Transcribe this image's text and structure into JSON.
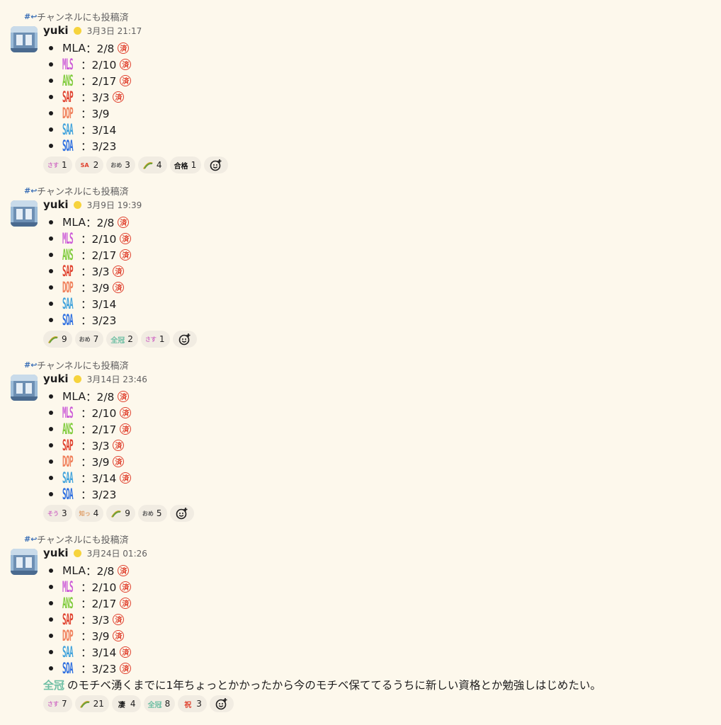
{
  "channel_note": "チャンネルにも投稿済",
  "messages": [
    {
      "user": "yuki",
      "time": "3月3日 21:17",
      "items": [
        {
          "cert": "MLA",
          "plain": true,
          "date": "2/8",
          "done": true
        },
        {
          "cert": "MLS",
          "color": "#cc5ad8",
          "date": "2/10",
          "done": true
        },
        {
          "cert": "ANS",
          "color": "#7ecb3a",
          "date": "2/17",
          "done": true
        },
        {
          "cert": "SAP",
          "color": "#e0412e",
          "date": "3/3",
          "done": true
        },
        {
          "cert": "DOP",
          "color": "#f07f5a",
          "date": "3/9",
          "done": false
        },
        {
          "cert": "SAA",
          "color": "#3fa2dc",
          "date": "3/14",
          "done": false
        },
        {
          "cert": "SOA",
          "color": "#2b6de0",
          "date": "3/23",
          "done": false
        }
      ],
      "reactions": [
        {
          "emoji": "さすが",
          "color": "#d06dc4",
          "count": "1"
        },
        {
          "emoji": "SAP",
          "color": "#e0412e",
          "count": "2"
        },
        {
          "emoji": "おめでとう",
          "color": "#555555",
          "count": "3"
        },
        {
          "emoji": "taco",
          "color": "#b28a26",
          "count": "4"
        },
        {
          "emoji": "合格",
          "color": "#111111",
          "count": "1"
        }
      ]
    },
    {
      "user": "yuki",
      "time": "3月9日 19:39",
      "items": [
        {
          "cert": "MLA",
          "plain": true,
          "date": "2/8",
          "done": true
        },
        {
          "cert": "MLS",
          "color": "#cc5ad8",
          "date": "2/10",
          "done": true
        },
        {
          "cert": "ANS",
          "color": "#7ecb3a",
          "date": "2/17",
          "done": true
        },
        {
          "cert": "SAP",
          "color": "#e0412e",
          "date": "3/3",
          "done": true
        },
        {
          "cert": "DOP",
          "color": "#f07f5a",
          "date": "3/9",
          "done": true
        },
        {
          "cert": "SAA",
          "color": "#3fa2dc",
          "date": "3/14",
          "done": false
        },
        {
          "cert": "SOA",
          "color": "#2b6de0",
          "date": "3/23",
          "done": false
        }
      ],
      "reactions": [
        {
          "emoji": "taco",
          "color": "#b28a26",
          "count": "9"
        },
        {
          "emoji": "おめでとう",
          "color": "#555555",
          "count": "7"
        },
        {
          "emoji": "全冠",
          "color": "#6fbfa4",
          "count": "2"
        },
        {
          "emoji": "さすが",
          "color": "#d06dc4",
          "count": "1"
        }
      ]
    },
    {
      "user": "yuki",
      "time": "3月14日 23:46",
      "items": [
        {
          "cert": "MLA",
          "plain": true,
          "date": "2/8",
          "done": true
        },
        {
          "cert": "MLS",
          "color": "#cc5ad8",
          "date": "2/10",
          "done": true
        },
        {
          "cert": "ANS",
          "color": "#7ecb3a",
          "date": "2/17",
          "done": true
        },
        {
          "cert": "SAP",
          "color": "#e0412e",
          "date": "3/3",
          "done": true
        },
        {
          "cert": "DOP",
          "color": "#f07f5a",
          "date": "3/9",
          "done": true
        },
        {
          "cert": "SAA",
          "color": "#3fa2dc",
          "date": "3/14",
          "done": true
        },
        {
          "cert": "SOA",
          "color": "#2b6de0",
          "date": "3/23",
          "done": false
        }
      ],
      "reactions": [
        {
          "emoji": "そうだよ",
          "color": "#d06dc4",
          "count": "3"
        },
        {
          "emoji": "知ってました",
          "color": "#e0a06a",
          "count": "4"
        },
        {
          "emoji": "taco",
          "color": "#b28a26",
          "count": "9"
        },
        {
          "emoji": "おめでとう",
          "color": "#555555",
          "count": "5"
        }
      ]
    },
    {
      "user": "yuki",
      "time": "3月24日 01:26",
      "items": [
        {
          "cert": "MLA",
          "plain": true,
          "date": "2/8",
          "done": true
        },
        {
          "cert": "MLS",
          "color": "#cc5ad8",
          "date": "2/10",
          "done": true
        },
        {
          "cert": "ANS",
          "color": "#7ecb3a",
          "date": "2/17",
          "done": true
        },
        {
          "cert": "SAP",
          "color": "#e0412e",
          "date": "3/3",
          "done": true
        },
        {
          "cert": "DOP",
          "color": "#f07f5a",
          "date": "3/9",
          "done": true
        },
        {
          "cert": "SAA",
          "color": "#3fa2dc",
          "date": "3/14",
          "done": true
        },
        {
          "cert": "SOA",
          "color": "#2b6de0",
          "date": "3/23",
          "done": true
        }
      ],
      "body_icon": "全冠",
      "body_text": "のモチベ湧くまでに1年ちょっとかかったから今のモチベ保ててるうちに新しい資格とか勉強しはじめたい。",
      "reactions": [
        {
          "emoji": "さすが",
          "color": "#d06dc4",
          "count": "7"
        },
        {
          "emoji": "taco",
          "color": "#b28a26",
          "count": "21"
        },
        {
          "emoji": "凄",
          "color": "#111111",
          "count": "4"
        },
        {
          "emoji": "全冠",
          "color": "#6fbfa4",
          "count": "8"
        },
        {
          "emoji": "祝",
          "color": "#e0412e",
          "count": "3"
        }
      ]
    }
  ],
  "colors": {
    "background": "#fdf8ec",
    "done_mark": "#e0412e",
    "reaction_bg": "#f1ece2"
  },
  "icons": {
    "channel": "hash-share-icon",
    "done": "sumi-done-icon",
    "add_reaction": "add-reaction-icon",
    "status": "status-emoji-icon"
  }
}
